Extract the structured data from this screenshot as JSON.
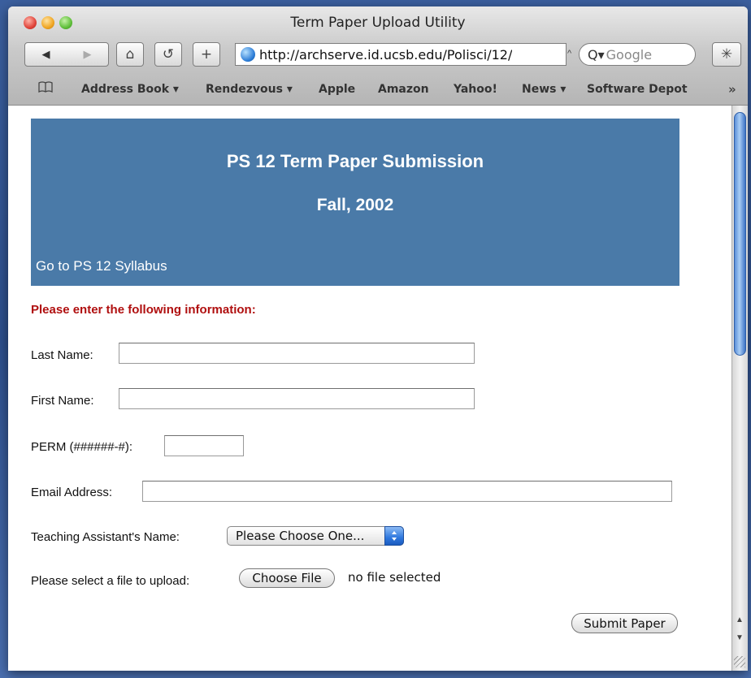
{
  "window": {
    "title": "Term Paper Upload Utility"
  },
  "toolbar": {
    "back_icon": "◀",
    "forward_icon": "▶",
    "home_icon": "⌂",
    "reload_icon": "↺",
    "add_icon": "+",
    "url": "http://archserve.id.ucsb.edu/Polisci/12/",
    "url_dropdown_icon": "^",
    "search_placeholder": "Google",
    "search_prefix": "Q▾",
    "bug_icon": "✳"
  },
  "bookmarks": {
    "book_icon": "📖",
    "items": [
      "Address Book ▾",
      "Rendezvous ▾",
      "Apple",
      "Amazon",
      "Yahoo!",
      "News ▾",
      "Software Depot"
    ],
    "overflow_icon": "»"
  },
  "page": {
    "title": "PS 12 Term Paper Submission",
    "subtitle": "Fall, 2002",
    "syllabus_link": "Go to PS 12 Syllabus",
    "instructions": "Please enter the following information:",
    "last_name_label": "Last Name:",
    "first_name_label": "First Name:",
    "perm_label": "PERM (######-#):",
    "email_label": "Email Address:",
    "ta_label": "Teaching Assistant's Name:",
    "ta_selected": "Please Choose One...",
    "file_label": "Please select a file to upload:",
    "choose_file": "Choose File",
    "no_file": "no file selected",
    "submit": "Submit Paper"
  },
  "colors": {
    "header_band": "#4a7aa8",
    "instructions_text": "#b00f0f"
  }
}
